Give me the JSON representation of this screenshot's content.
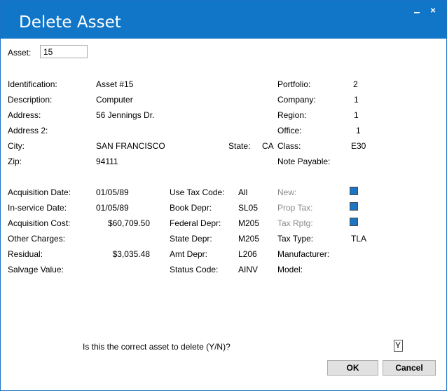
{
  "window": {
    "title": "Delete Asset",
    "minimize_glyph": "_",
    "close_glyph": "×"
  },
  "asset": {
    "label": "Asset:",
    "value": "15"
  },
  "left": {
    "identification": {
      "label": "Identification:",
      "value": "Asset #15"
    },
    "description": {
      "label": "Description:",
      "value": "Computer"
    },
    "address": {
      "label": "Address:",
      "value": "56 Jennings Dr."
    },
    "address2": {
      "label": "Address 2:",
      "value": ""
    },
    "city": {
      "label": "City:",
      "value": "SAN FRANCISCO"
    },
    "zip": {
      "label": "Zip:",
      "value": "94111"
    },
    "state": {
      "label": "State:",
      "value": "CA"
    }
  },
  "right": {
    "portfolio": {
      "label": "Portfolio:",
      "value": "2"
    },
    "company": {
      "label": "Company:",
      "value": "1"
    },
    "region": {
      "label": "Region:",
      "value": "1"
    },
    "office": {
      "label": "Office:",
      "value": "1"
    },
    "class": {
      "label": "Class:",
      "value": "E30"
    },
    "note_payable": {
      "label": "Note Payable:",
      "value": ""
    }
  },
  "financial": {
    "acquisition_date": {
      "label": "Acquisition Date:",
      "value": "01/05/89"
    },
    "in_service_date": {
      "label": "In-service Date:",
      "value": "01/05/89"
    },
    "acquisition_cost": {
      "label": "Acquisition Cost:",
      "value": "$60,709.50"
    },
    "other_charges": {
      "label": "Other Charges:",
      "value": ""
    },
    "residual": {
      "label": "Residual:",
      "value": "$3,035.48"
    },
    "salvage_value": {
      "label": "Salvage Value:",
      "value": ""
    }
  },
  "tax": {
    "use_tax_code": {
      "label": "Use Tax Code:",
      "value": "All"
    },
    "book_depr": {
      "label": "Book Depr:",
      "value": "SL05"
    },
    "federal_depr": {
      "label": "Federal Depr:",
      "value": "M205"
    },
    "state_depr": {
      "label": "State Depr:",
      "value": "M205"
    },
    "amt_depr": {
      "label": "Amt Depr:",
      "value": "L206"
    },
    "status_code": {
      "label": "Status Code:",
      "value": "AINV"
    }
  },
  "flags": {
    "new": {
      "label": "New:",
      "checked": true
    },
    "prop_tax": {
      "label": "Prop Tax:",
      "checked": true
    },
    "tax_rptg": {
      "label": "Tax Rptg:",
      "checked": true
    },
    "tax_type": {
      "label": "Tax Type:",
      "value": "TLA"
    },
    "manufacturer": {
      "label": "Manufacturer:",
      "value": ""
    },
    "model": {
      "label": "Model:",
      "value": ""
    }
  },
  "prompt": {
    "question": "Is this the correct asset to delete (Y/N)?",
    "answer": "Y"
  },
  "buttons": {
    "ok": "OK",
    "cancel": "Cancel"
  },
  "colors": {
    "titlebar": "#1176c8",
    "checkbox": "#1e74c1",
    "disabled_label": "#8a8a8a"
  }
}
